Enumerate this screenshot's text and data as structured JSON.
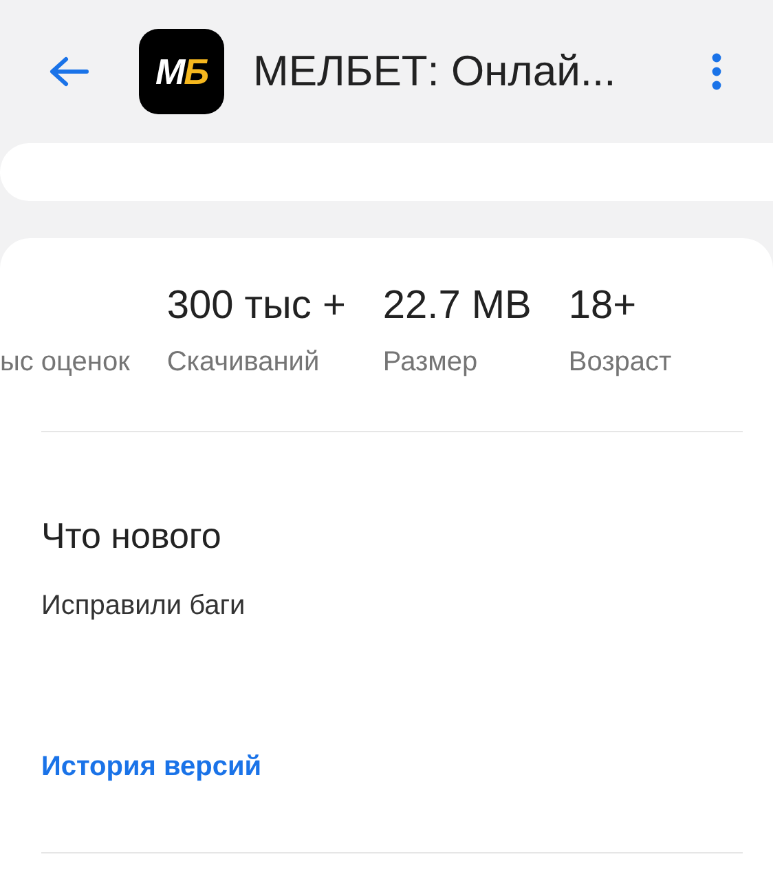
{
  "header": {
    "title": "МЕЛБЕТ: Онлай...",
    "logo_text": "МБ"
  },
  "stats": [
    {
      "label": "ыс оценок"
    },
    {
      "value": "300 тыс +",
      "label": "Скачиваний"
    },
    {
      "value": "22.7 MB",
      "label": "Размер"
    },
    {
      "value": "18+",
      "label": "Возраст"
    }
  ],
  "whats_new": {
    "title": "Что нового",
    "text": "Исправили баги",
    "link": "История версий"
  }
}
